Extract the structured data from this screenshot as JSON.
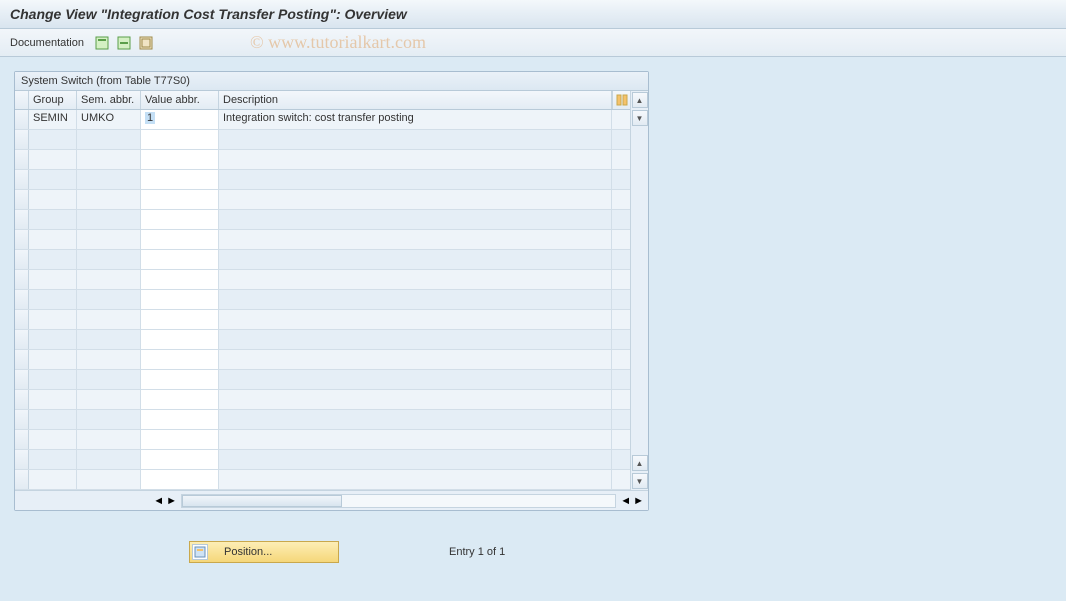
{
  "title": "Change View \"Integration Cost Transfer Posting\": Overview",
  "toolbar": {
    "documentation_label": "Documentation"
  },
  "watermark": "© www.tutorialkart.com",
  "panel": {
    "header": "System Switch (from Table T77S0)",
    "columns": {
      "group": "Group",
      "sem": "Sem. abbr.",
      "val": "Value abbr.",
      "desc": "Description"
    },
    "rows": [
      {
        "group": "SEMIN",
        "sem": "UMKO",
        "val": "1",
        "desc": "Integration switch: cost transfer posting"
      }
    ],
    "empty_row_count": 18
  },
  "footer": {
    "position_label": "Position...",
    "entry_text": "Entry 1 of 1"
  }
}
